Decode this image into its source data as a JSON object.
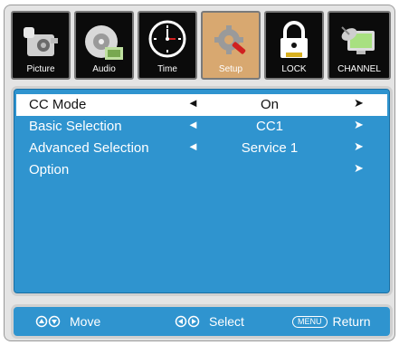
{
  "tabs": [
    {
      "label": "Picture",
      "icon": "picture-icon",
      "selected": false
    },
    {
      "label": "Audio",
      "icon": "audio-icon",
      "selected": false
    },
    {
      "label": "Time",
      "icon": "clock-icon",
      "selected": false
    },
    {
      "label": "Setup",
      "icon": "setup-icon",
      "selected": true
    },
    {
      "label": "LOCK",
      "icon": "lock-icon",
      "selected": false
    },
    {
      "label": "CHANNEL",
      "icon": "channel-icon",
      "selected": false
    }
  ],
  "menu": {
    "rows": [
      {
        "label": "CC Mode",
        "value": "On",
        "left_arrow": "◄",
        "right_arrow": "➤"
      },
      {
        "label": "Basic Selection",
        "value": "CC1",
        "left_arrow": "◄",
        "right_arrow": "➤"
      },
      {
        "label": "Advanced Selection",
        "value": "Service 1",
        "left_arrow": "◄",
        "right_arrow": "➤"
      },
      {
        "label": "Option",
        "value": "",
        "left_arrow": "",
        "right_arrow": "➤"
      }
    ]
  },
  "footer": {
    "move_label": "Move",
    "select_label": "Select",
    "menu_key": "MENU",
    "return_label": "Return"
  },
  "colors": {
    "panel": "#2f94cf",
    "selected_tab": "#d8a870",
    "tab_bg": "#0b0b0b",
    "highlight_row": "#ffffff"
  }
}
